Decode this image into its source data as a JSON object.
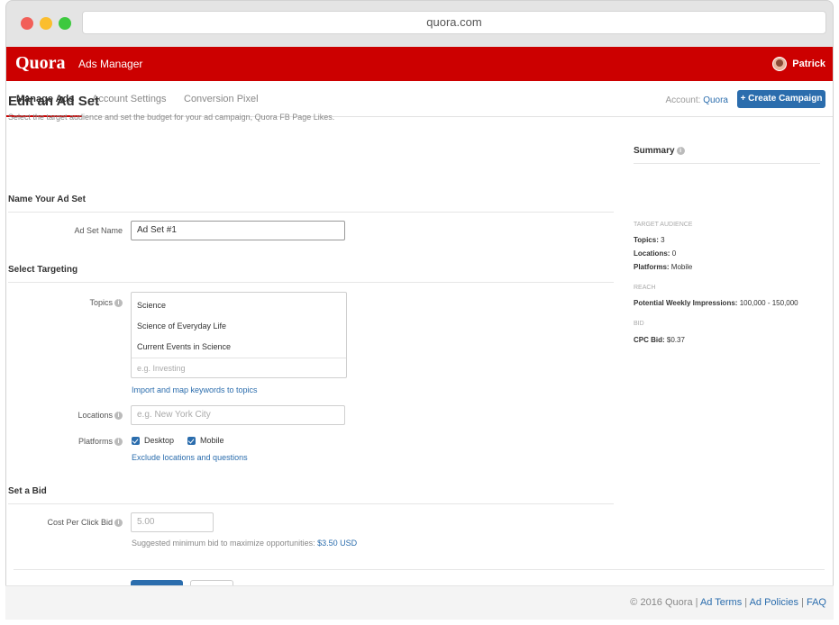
{
  "browser": {
    "url": "quora.com"
  },
  "topbar": {
    "logo": "Quora",
    "app_name": "Ads Manager",
    "user_name": "Patrick"
  },
  "tabs": [
    {
      "label": "Manage Ads",
      "active": true
    },
    {
      "label": "Account Settings",
      "active": false
    },
    {
      "label": "Conversion Pixel",
      "active": false
    }
  ],
  "account": {
    "label": "Account:",
    "name": "Quora"
  },
  "create_button": "+ Create Campaign",
  "page": {
    "title": "Edit an Ad Set",
    "subtitle": "Select the target audience and set the budget for your ad campaign, Quora FB Page Likes."
  },
  "name_section": {
    "heading": "Name Your Ad Set",
    "field_label": "Ad Set Name",
    "field_value": "Ad Set #1"
  },
  "targeting": {
    "heading": "Select Targeting",
    "topics_label": "Topics",
    "topics": [
      "Science",
      "Science of Everyday Life",
      "Current Events in Science"
    ],
    "topics_placeholder": "e.g. Investing",
    "import_link": "Import and map keywords to topics",
    "locations_label": "Locations",
    "locations_placeholder": "e.g. New York City",
    "platforms_label": "Platforms",
    "platforms": [
      {
        "label": "Desktop",
        "checked": true
      },
      {
        "label": "Mobile",
        "checked": true
      }
    ],
    "exclude_link": "Exclude locations and questions"
  },
  "bid": {
    "heading": "Set a Bid",
    "label": "Cost Per Click Bid",
    "placeholder": "5.00",
    "note": "Suggested minimum bid to maximize opportunities:",
    "note_value": "$3.50 USD"
  },
  "summary": {
    "heading": "Summary",
    "target_caption": "TARGET AUDIENCE",
    "topics_key": "Topics:",
    "topics_val": "3",
    "locations_key": "Locations:",
    "locations_val": "0",
    "platforms_key": "Platforms:",
    "platforms_val": "Mobile",
    "reach_caption": "REACH",
    "reach_key": "Potential Weekly Impressions:",
    "reach_val": "100,000 - 150,000",
    "bid_caption": "BID",
    "cpc_key": "CPC Bid:",
    "cpc_val": "$0.37"
  },
  "footer": {
    "copyright": "© 2016 Quora",
    "sep": "|",
    "ad_terms": "Ad Terms",
    "ad_policies": "Ad Policies",
    "faq": "FAQ"
  },
  "colors": {
    "brand_red": "#cc0000",
    "accent_blue": "#2b6dad"
  }
}
